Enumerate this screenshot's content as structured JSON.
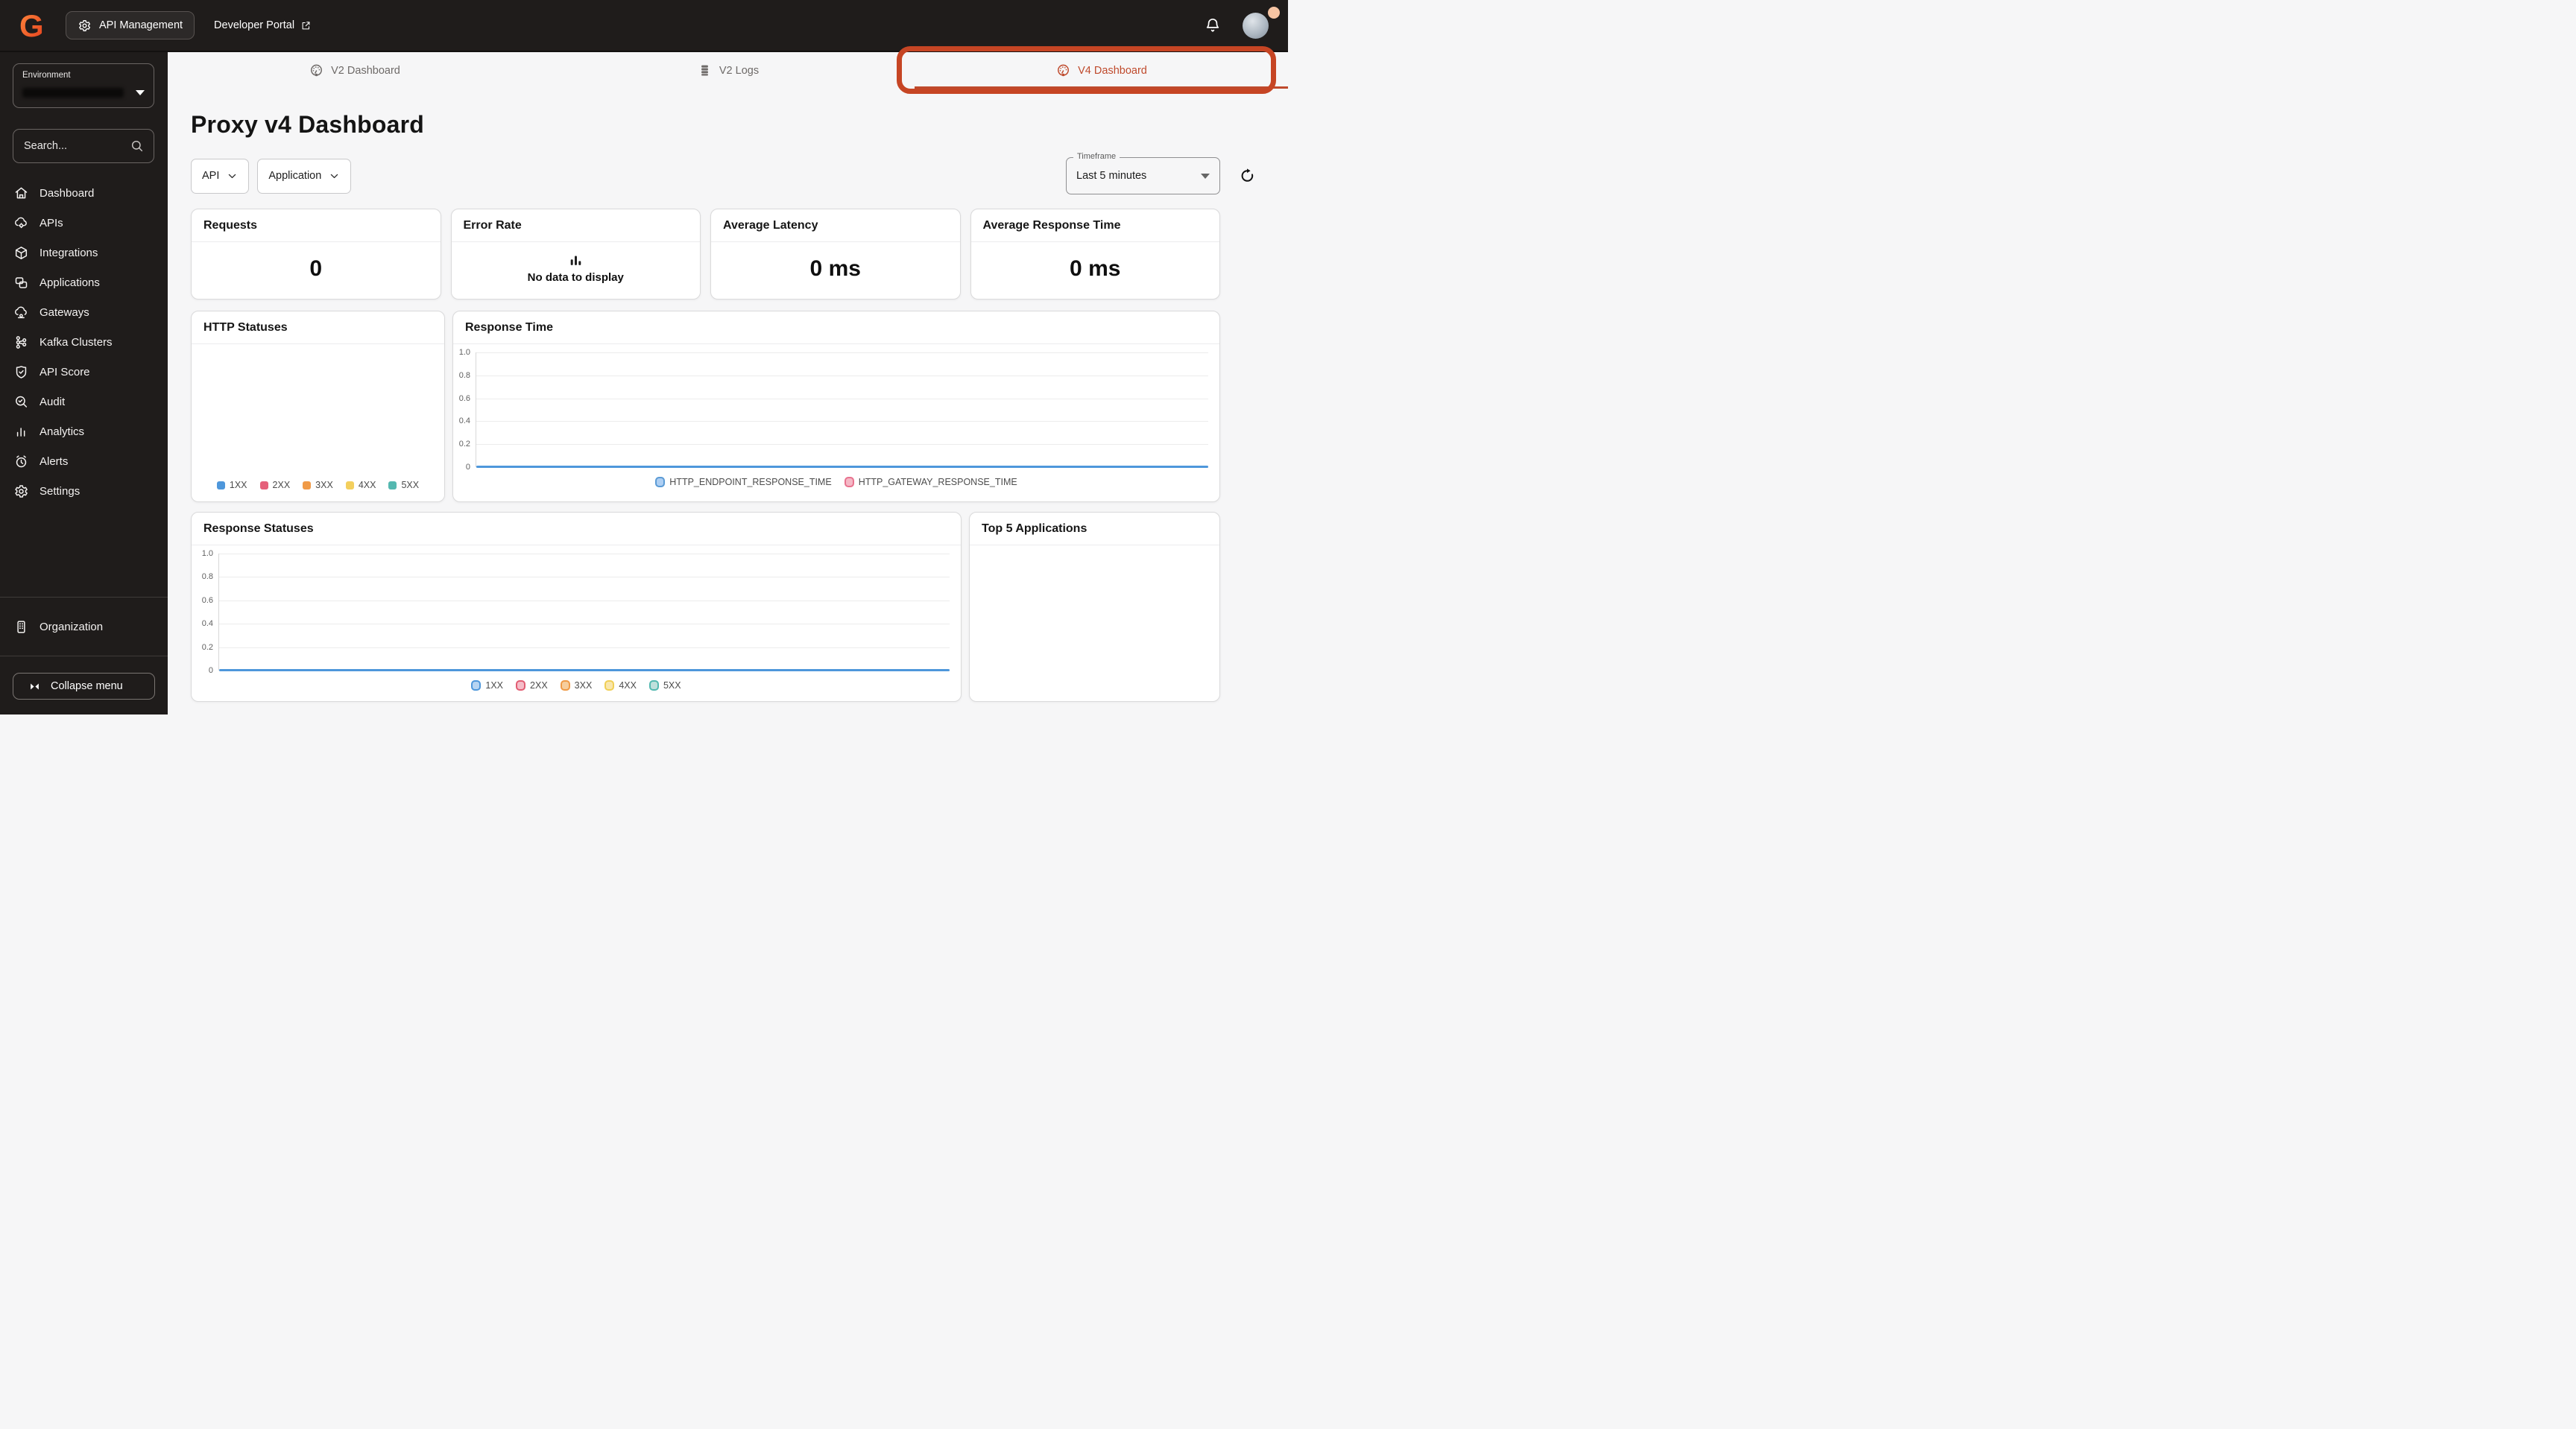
{
  "topbar": {
    "logo_letter": "G",
    "app_switcher_label": "API Management",
    "developer_portal_label": "Developer Portal"
  },
  "sidebar": {
    "environment_label": "Environment",
    "environment_value_redacted": true,
    "search_placeholder": "Search...",
    "items": [
      {
        "slug": "dashboard",
        "label": "Dashboard",
        "icon": "home-icon"
      },
      {
        "slug": "apis",
        "label": "APIs",
        "icon": "cloud-gear-icon"
      },
      {
        "slug": "integrations",
        "label": "Integrations",
        "icon": "cube-icon"
      },
      {
        "slug": "applications",
        "label": "Applications",
        "icon": "copies-icon"
      },
      {
        "slug": "gateways",
        "label": "Gateways",
        "icon": "cloud-node-icon"
      },
      {
        "slug": "kafka-clusters",
        "label": "Kafka Clusters",
        "icon": "kafka-icon"
      },
      {
        "slug": "api-score",
        "label": "API Score",
        "icon": "shield-check-icon"
      },
      {
        "slug": "audit",
        "label": "Audit",
        "icon": "audit-icon"
      },
      {
        "slug": "analytics",
        "label": "Analytics",
        "icon": "bar-chart-icon"
      },
      {
        "slug": "alerts",
        "label": "Alerts",
        "icon": "alarm-clock-icon"
      },
      {
        "slug": "settings",
        "label": "Settings",
        "icon": "gear-icon"
      }
    ],
    "organization_label": "Organization",
    "collapse_label": "Collapse menu"
  },
  "tabs": [
    {
      "slug": "v2-dashboard",
      "label": "V2 Dashboard",
      "icon": "gauge-icon",
      "active": false
    },
    {
      "slug": "v2-logs",
      "label": "V2 Logs",
      "icon": "logs-icon",
      "active": false
    },
    {
      "slug": "v4-dashboard",
      "label": "V4 Dashboard",
      "icon": "gauge-icon",
      "active": true
    }
  ],
  "page": {
    "title": "Proxy v4 Dashboard"
  },
  "filters": {
    "api_label": "API",
    "application_label": "Application",
    "timeframe_label": "Timeframe",
    "timeframe_value": "Last 5 minutes"
  },
  "stat_cards": [
    {
      "title": "Requests",
      "value": "0"
    },
    {
      "title": "Error Rate",
      "empty_text": "No data to display"
    },
    {
      "title": "Average Latency",
      "value": "0 ms"
    },
    {
      "title": "Average Response Time",
      "value": "0 ms"
    }
  ],
  "top5": {
    "title": "Top 5 Applications"
  },
  "colors": {
    "accent_active_tab": "#bf4a2c",
    "annotation_border": "#c64524",
    "topbar_bg": "#1f1c1b",
    "sidebar_bg": "#1f1c1b",
    "page_bg": "#f6f6f7",
    "card_bg": "#ffffff",
    "card_border": "#dadadb",
    "logo_gradient": [
      "#ff8a3e",
      "#e33d1c"
    ],
    "presence_dot": "#f6c4a3",
    "line_blue": "#4e97db"
  },
  "chart_data": [
    {
      "id": "http-statuses",
      "type": "line",
      "title": "HTTP Statuses",
      "legend_position": "bottom",
      "legend_style": "filled",
      "no_data": true,
      "series": [
        {
          "name": "1XX",
          "color": "#4e97db",
          "values": []
        },
        {
          "name": "2XX",
          "color": "#e5607a",
          "values": []
        },
        {
          "name": "3XX",
          "color": "#f09a47",
          "values": []
        },
        {
          "name": "4XX",
          "color": "#f3cf5d",
          "values": []
        },
        {
          "name": "5XX",
          "color": "#54b8b0",
          "values": []
        }
      ]
    },
    {
      "id": "response-time",
      "type": "line",
      "title": "Response Time",
      "ylim": [
        0,
        1
      ],
      "yticks": [
        "1.0",
        "0.8",
        "0.6",
        "0.4",
        "0.2",
        "0"
      ],
      "grid": true,
      "legend_position": "bottom",
      "legend_style": "outlined",
      "line_color": "#4e97db",
      "series": [
        {
          "name": "HTTP_ENDPOINT_RESPONSE_TIME",
          "fill": "#aecff3",
          "border": "#5b9bd5",
          "constant_value": 0
        },
        {
          "name": "HTTP_GATEWAY_RESPONSE_TIME",
          "fill": "#f5b8c6",
          "border": "#e8738f",
          "constant_value": 0
        }
      ]
    },
    {
      "id": "response-statuses",
      "type": "line",
      "title": "Response Statuses",
      "ylim": [
        0,
        1
      ],
      "yticks": [
        "1.0",
        "0.8",
        "0.6",
        "0.4",
        "0.2",
        "0"
      ],
      "grid": true,
      "legend_position": "bottom",
      "legend_style": "outlined",
      "line_color": "#4e97db",
      "series": [
        {
          "name": "1XX",
          "fill": "#b6d4f2",
          "border": "#4e97db",
          "constant_value": 0
        },
        {
          "name": "2XX",
          "fill": "#f5bcc8",
          "border": "#e25c72",
          "constant_value": 0
        },
        {
          "name": "3XX",
          "fill": "#f6cd9c",
          "border": "#ef9a46",
          "constant_value": 0
        },
        {
          "name": "4XX",
          "fill": "#f9e6ab",
          "border": "#f0cf55",
          "constant_value": 0
        },
        {
          "name": "5XX",
          "fill": "#bfe0dc",
          "border": "#54b8b0",
          "constant_value": 0
        }
      ]
    }
  ]
}
